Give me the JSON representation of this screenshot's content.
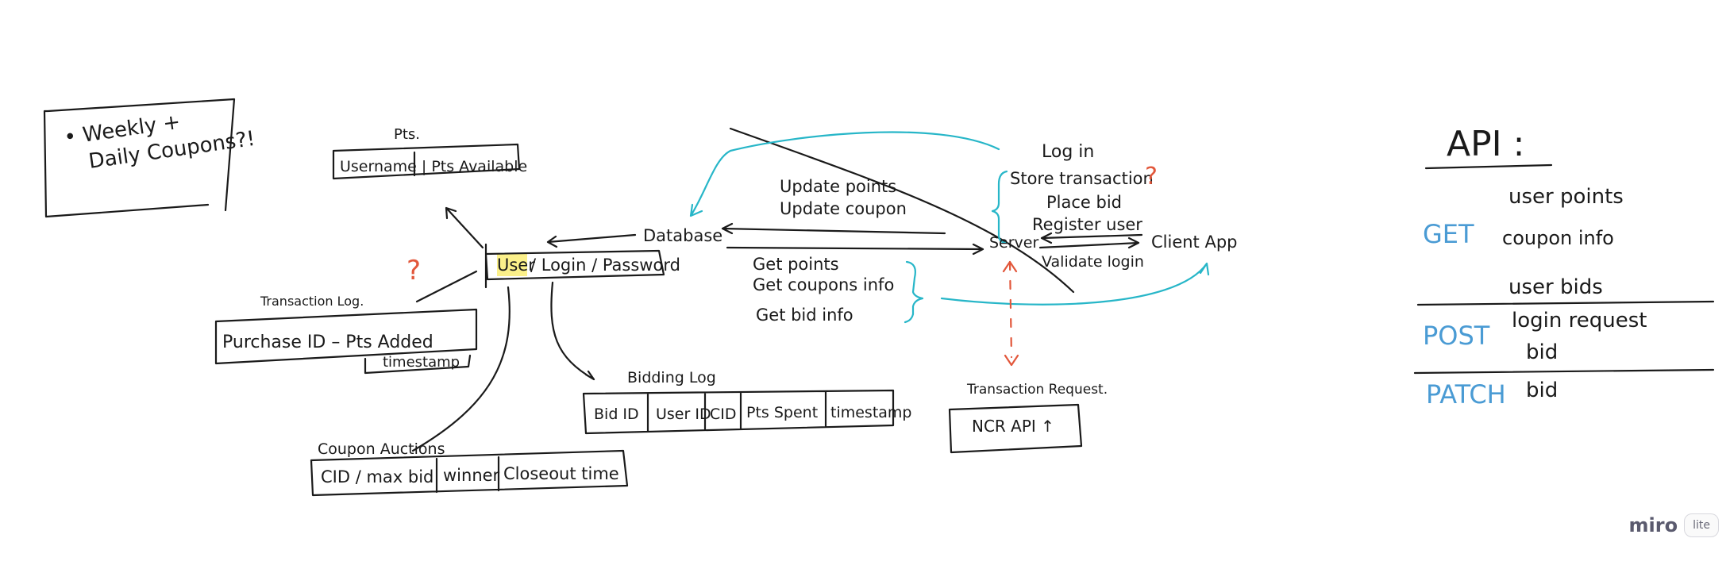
{
  "note": {
    "lines": [
      "• Weekly +",
      "Daily Coupons?!"
    ]
  },
  "pts_table": {
    "label": "Pts.",
    "row": "Username | Pts Available"
  },
  "user_table": {
    "user": "User",
    "rest": "/ Login / Password"
  },
  "database_label": "Database",
  "transaction_log": {
    "label": "Transaction Log.",
    "row": "Purchase ID  –  Pts Added",
    "timestamp": "timestamp"
  },
  "bidding_log": {
    "label": "Bidding Log",
    "cells": [
      "Bid ID",
      "User ID",
      "CID",
      "Pts Spent",
      "timestamp"
    ]
  },
  "coupon_auctions": {
    "label": "Coupon Auctions",
    "cells": [
      "CID  /  max bid",
      "winner",
      "Closeout time"
    ]
  },
  "server_label": "Server",
  "client_label": "Client App",
  "updates": [
    "Update points",
    "Update coupon"
  ],
  "gets": [
    "Get points",
    "Get coupons info",
    "Get bid info"
  ],
  "client_actions": [
    "Log in",
    "Store transaction",
    "Place bid",
    "Register user",
    "Validate login"
  ],
  "transaction_request": {
    "label": "Transaction Request.",
    "box": "NCR API ↑"
  },
  "question_marks": [
    "?",
    "?"
  ],
  "api": {
    "title": "API :",
    "get_label": "GET",
    "get_items": [
      "user points",
      "coupon info",
      "user bids"
    ],
    "post_label": "POST",
    "post_items": [
      "login request",
      "bid"
    ],
    "patch_label": "PATCH",
    "patch_items": [
      "bid"
    ]
  },
  "branding": {
    "logo": "miro",
    "badge": "lite"
  },
  "colors": {
    "ink": "#1a1a1a",
    "cyan": "#27b6c8",
    "red": "#e2573b",
    "api_blue": "#4a9bd4",
    "highlight": "#fbf08a"
  }
}
